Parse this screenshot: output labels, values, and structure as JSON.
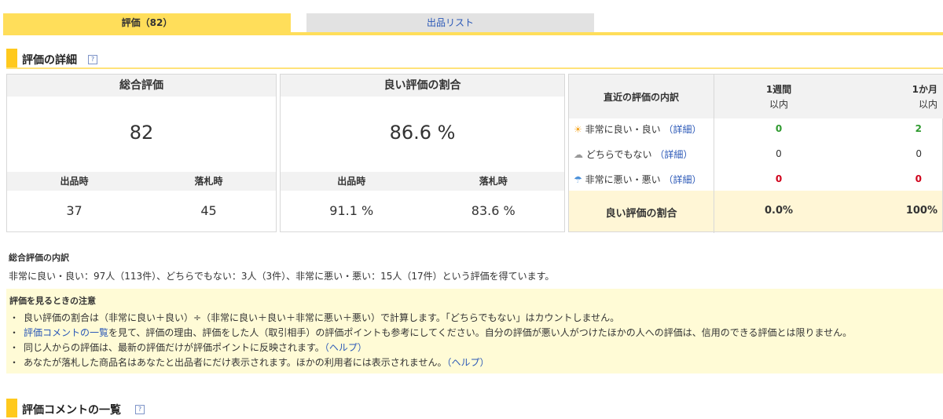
{
  "tabs": {
    "active": "評価（82）",
    "other": "出品リスト"
  },
  "detail": {
    "title": "評価の詳細",
    "help": "?"
  },
  "overall": {
    "header": "総合評価",
    "value": "82",
    "sub_left": "出品時",
    "sub_right": "落札時",
    "val_left": "37",
    "val_right": "45"
  },
  "good_ratio": {
    "header": "良い評価の割合",
    "value": "86.6 %",
    "sub_left": "出品時",
    "sub_right": "落札時",
    "val_left": "91.1 %",
    "val_right": "83.6 %"
  },
  "recent": {
    "header_label": "直近の評価の内訳",
    "col_week_line1": "1週間",
    "col_week_line2": "以内",
    "col_month_line1": "1か月",
    "col_month_line2": "以内",
    "rows": [
      {
        "label": "非常に良い・良い",
        "link": "（詳細）",
        "week": "0",
        "month": "2"
      },
      {
        "label": "どちらでもない",
        "link": "（詳細）",
        "week": "0",
        "month": "0"
      },
      {
        "label": "非常に悪い・悪い",
        "link": "（詳細）",
        "week": "0",
        "month": "0"
      }
    ],
    "footer_label": "良い評価の割合",
    "footer_week": "0.0%",
    "footer_month": "100%"
  },
  "summary": {
    "title": "総合評価の内訳",
    "text": "非常に良い・良い：97人（113件）、どちらでもない：3人（3件）、非常に悪い・悪い：15人（17件）という評価を得ています。"
  },
  "notes": {
    "title": "評価を見るときの注意",
    "bullet": "・",
    "item1": "良い評価の割合は（非常に良い＋良い）÷（非常に良い＋良い＋非常に悪い＋悪い）で計算します。「どちらでもない」はカウントしません。",
    "item2_link": "評価コメントの一覧",
    "item2_rest": "を見て、評価の理由、評価をした人（取引相手）の評価ポイントも参考にしてください。自分の評価が悪い人がつけたほかの人への評価は、信用のできる評価とは限りません。",
    "item3": "同じ人からの評価は、最新の評価だけが評価ポイントに反映されます。",
    "item3_link": "（ヘルプ）",
    "item4": "あなたが落札した商品名はあなたと出品者にだけ表示されます。ほかの利用者には表示されません。",
    "item4_link": "（ヘルプ）"
  },
  "comments": {
    "title": "評価コメントの一覧",
    "help": "?"
  }
}
